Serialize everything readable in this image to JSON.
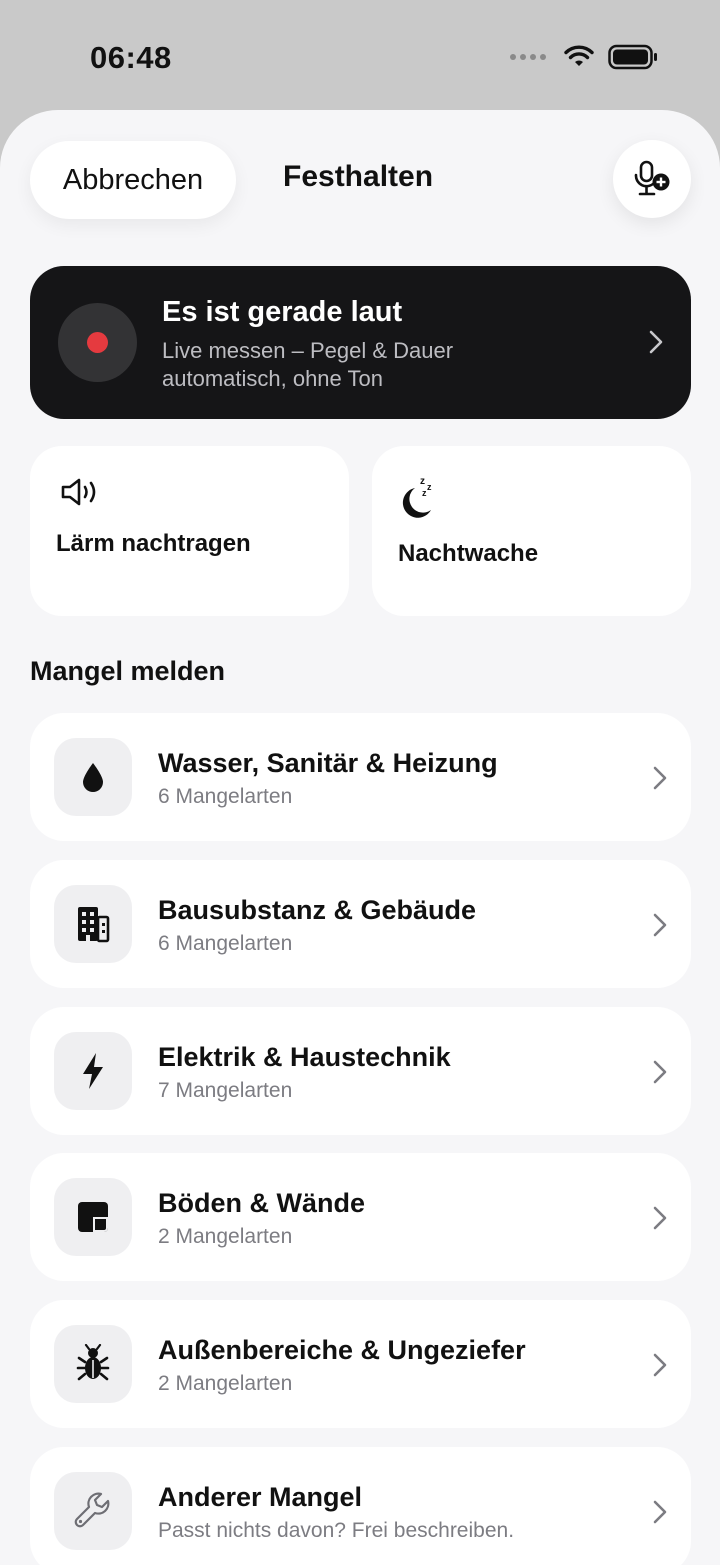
{
  "status_bar": {
    "time": "06:48"
  },
  "header": {
    "cancel_label": "Abbrechen",
    "title": "Festhalten",
    "mic_icon": "microphone-plus-icon"
  },
  "live_card": {
    "title": "Es ist gerade laut",
    "subtitle_line1": "Live messen – Pegel & Dauer",
    "subtitle_line2": "automatisch, ohne Ton",
    "record_color": "#e53a3f"
  },
  "tiles": [
    {
      "label": "Lärm nachtragen",
      "icon": "speaker-icon"
    },
    {
      "label": "Nachtwache",
      "icon": "moon-sleep-icon"
    }
  ],
  "section": {
    "title": "Mangel melden"
  },
  "categories": [
    {
      "title": "Wasser, Sanitär & Heizung",
      "subtitle": "6 Mangelarten",
      "icon": "water-drop-icon"
    },
    {
      "title": "Bausubstanz & Gebäude",
      "subtitle": "6 Mangelarten",
      "icon": "building-icon"
    },
    {
      "title": "Elektrik & Haustechnik",
      "subtitle": "7 Mangelarten",
      "icon": "lightning-icon"
    },
    {
      "title": "Böden & Wände",
      "subtitle": "2 Mangelarten",
      "icon": "wall-panel-icon"
    },
    {
      "title": "Außenbereiche & Ungeziefer",
      "subtitle": "2 Mangelarten",
      "icon": "bug-icon"
    },
    {
      "title": "Anderer Mangel",
      "subtitle": "Passt nichts davon? Frei beschreiben.",
      "icon": "wrench-icon"
    }
  ],
  "colors": {
    "background": "#f6f6f8",
    "card": "#ffffff",
    "dark_card": "#151517",
    "accent_red": "#e53a3f"
  }
}
